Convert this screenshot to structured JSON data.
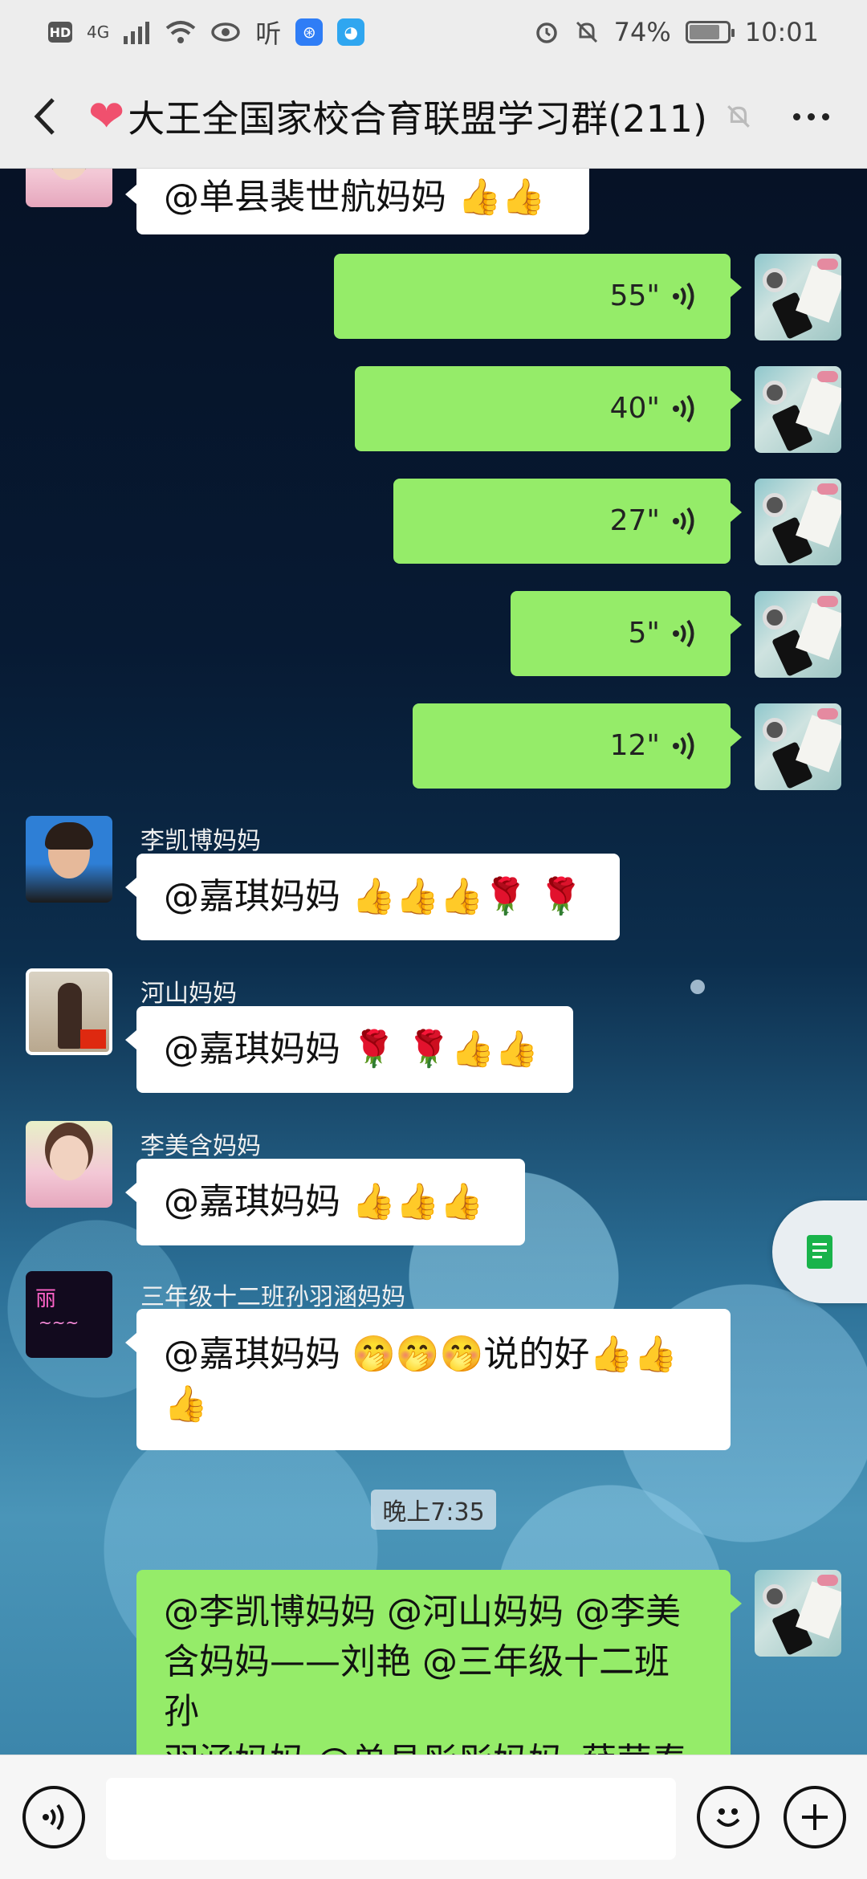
{
  "status_bar": {
    "network": "4G",
    "listen_label": "听",
    "battery": "74%",
    "battery_level": 0.74,
    "time": "10:01"
  },
  "header": {
    "title": "大王全国家校合育联盟学习群(211)"
  },
  "messages": {
    "top_partial": {
      "text": "@单县裴世航妈妈 👍👍"
    },
    "voice": [
      {
        "duration": "55\""
      },
      {
        "duration": "40\""
      },
      {
        "duration": "27\""
      },
      {
        "duration": "5\""
      },
      {
        "duration": "12\""
      }
    ],
    "m1": {
      "sender": "李凯博妈妈",
      "text": "@嘉琪妈妈 👍👍👍🌹 🌹"
    },
    "m2": {
      "sender": "河山妈妈",
      "text": "@嘉琪妈妈 🌹 🌹👍👍"
    },
    "m3": {
      "sender": "李美含妈妈",
      "text": "@嘉琪妈妈 👍👍👍"
    },
    "m4": {
      "sender": "三年级十二班孙羽涵妈妈",
      "line1": "@嘉琪妈妈 🤭🤭🤭说的好👍👍",
      "line2": "👍"
    },
    "time_divider": "晚上7:35",
    "m5": {
      "line1": "@李凯博妈妈 @河山妈妈 @李美",
      "line2": "含妈妈——刘艳 @三年级十二班孙",
      "line3": "羽涵妈妈 @单县彤彤妈妈_薛荣春"
    },
    "avatar4_text": "丽"
  },
  "colors": {
    "my_bubble": "#95ec69",
    "their_bubble": "#ffffff",
    "header_bg": "#ededed"
  }
}
